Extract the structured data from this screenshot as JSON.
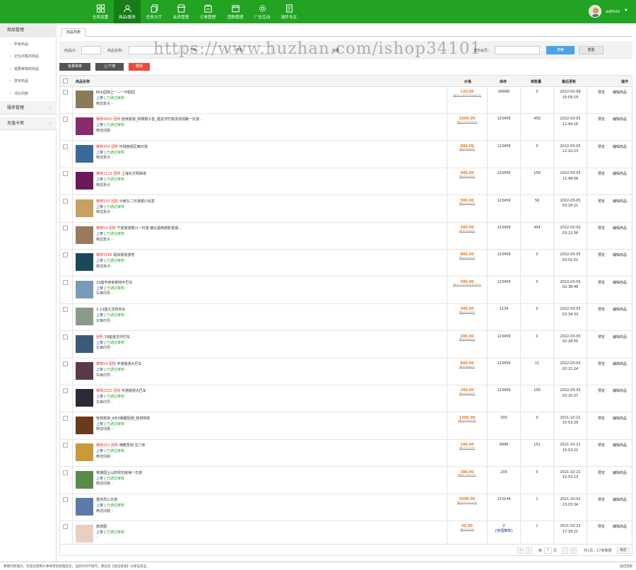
{
  "nav": {
    "items": [
      {
        "label": "全局设置",
        "icon": "grid-icon"
      },
      {
        "label": "商品/服务",
        "icon": "user-icon"
      },
      {
        "label": "任务大厅",
        "icon": "copy-icon"
      },
      {
        "label": "会员管理",
        "icon": "shop-icon"
      },
      {
        "label": "订单管理",
        "icon": "store-icon"
      },
      {
        "label": "团购管理",
        "icon": "calendar-icon"
      },
      {
        "label": "广告互动",
        "icon": "gear-icon"
      },
      {
        "label": "插件专区",
        "icon": "doc-icon"
      }
    ],
    "active_index": 1,
    "user": "admin"
  },
  "sidebar": {
    "section": "商品管理",
    "items": [
      "所有商品",
      "正在出售的商品",
      "需要审核的商品",
      "发布商品",
      "评价列表"
    ],
    "groups": [
      "服务管理",
      "充值卡密"
    ]
  },
  "tab": "商品列表",
  "filters": {
    "id_label": "商品ID：",
    "name_label": "商品名称：",
    "select1": "-- 不限 --",
    "select2": "-- 不限 --",
    "sales_label": "销量",
    "member_label": "发布会员：",
    "search": "搜索",
    "reset": "重置"
  },
  "watermark": "https://www.huzhan.com/ishop34101",
  "actions": {
    "review": "批量审核",
    "onoff": "上/下架",
    "delete": "删除"
  },
  "table": {
    "headers": {
      "name": "商品名称",
      "price": "价格",
      "stock": "库存",
      "sold": "销售量",
      "updated": "最后更新",
      "ops": "操作"
    },
    "status_on": "上架",
    "status_ok": "已通过审核",
    "preview": "预览",
    "edit": "编辑商品",
    "rows": [
      {
        "tag": "",
        "title": "四大园林之一—一中韵园",
        "cat": "精选景点 -",
        "price": "120.00",
        "oprice": "原价100000000元",
        "stock": "99999",
        "sold": "0",
        "date": "2022-03-08",
        "time": "16:09:19",
        "thumb": "#8a7a5a"
      },
      {
        "tag": "推荐4450 团购",
        "title": "桂林旅游_阳朔银子岩_遇龙河竹筏漂流线路一日游...",
        "cat": "精选线路 -",
        "price": "1000.00",
        "oprice": "原价10000元",
        "stock": "123456",
        "sold": "456",
        "date": "2022-03-05",
        "time": "12:44:16",
        "thumb": "#8a2a6a"
      },
      {
        "tag": "推荐454 团购",
        "title": "环球度假区两日游",
        "cat": "精选景点 -",
        "price": "888.00",
        "oprice": "原价999元",
        "stock": "123456",
        "sold": "0",
        "date": "2022-03-05",
        "time": "12:10:23",
        "thumb": "#3a6a9a"
      },
      {
        "tag": "推荐1123 团购",
        "title": "上海东方明珠塔",
        "cat": "精选景点 -",
        "price": "400.00",
        "oprice": "原价999元",
        "stock": "123456",
        "sold": "156",
        "date": "2022-03-05",
        "time": "11:48:58",
        "thumb": "#6a1a5a"
      },
      {
        "tag": "推荐535 团购",
        "title": "沙坡头二日游银川出发",
        "cat": "精选景点 -",
        "price": "300.00",
        "oprice": "原价999元",
        "stock": "123456",
        "sold": "56",
        "date": "2022-03-05",
        "time": "03:18:21",
        "thumb": "#c8a060"
      },
      {
        "tag": "推荐54 团购",
        "title": "宁夏旅游银川一日游 镇北堡西部影视城...",
        "cat": "精选景点 -",
        "price": "300.00",
        "oprice": "原价999元",
        "stock": "123456",
        "sold": "454",
        "date": "2022-03-05",
        "time": "03:12:36",
        "thumb": "#9a7a5a"
      },
      {
        "tag": "推荐1566",
        "title": "极目极夜游览",
        "cat": "精选景点 -",
        "price": "800.00",
        "oprice": "原价999元",
        "stock": "123456",
        "sold": "0",
        "date": "2022-03-05",
        "time": "03:01:52",
        "thumb": "#1a4a5a"
      },
      {
        "tag": "",
        "title": "19座丰田考斯特中巴车",
        "cat": "车辆向导 -",
        "price": "300.00",
        "oprice": "原价100000000元",
        "stock": "123456",
        "sold": "0",
        "date": "2022-03-05",
        "time": "02:38:48",
        "thumb": "#7a9aba"
      },
      {
        "tag": "",
        "title": "2-13座九龙商务车",
        "cat": "车辆向导 -",
        "price": "300.00",
        "oprice": "原价999元",
        "stock": "1234",
        "sold": "0",
        "date": "2022-03-05",
        "time": "02:34:33",
        "thumb": "#8a9a8a"
      },
      {
        "tag": "团购",
        "title": "19座金龙中巴车",
        "cat": "车辆向导 -",
        "price": "200.00",
        "oprice": "原价999元",
        "stock": "123456",
        "sold": "0",
        "date": "2022-03-05",
        "time": "02:28:50",
        "thumb": "#3a5a7a"
      },
      {
        "tag": "推荐54 团购",
        "title": "宇通旅游大巴车",
        "cat": "车辆向导 -",
        "price": "800.00",
        "oprice": "原价999元",
        "stock": "123456",
        "sold": "11",
        "date": "2022-03-05",
        "time": "02:21:24",
        "thumb": "#5a3a4a"
      },
      {
        "tag": "推荐2322 团购",
        "title": "宇通旅游大巴车",
        "cat": "车辆向导 -",
        "price": "300.00",
        "oprice": "原价999元",
        "stock": "123456",
        "sold": "156",
        "date": "2022-03-05",
        "time": "02:10:37",
        "thumb": "#2a2a3a"
      },
      {
        "tag": "",
        "title": "桂林旅游_4天3晚跟团游_桂林阳桂",
        "cat": "精选线路 -",
        "price": "1300.00",
        "oprice": "原价1000元",
        "stock": "200",
        "sold": "0",
        "date": "2021-10-21",
        "time": "15:53:29",
        "thumb": "#6a3a1a"
      },
      {
        "tag": "推荐252 团购",
        "title": "佛教圣地-五门寺",
        "cat": "精选线路 -",
        "price": "100.00",
        "oprice": "原价200元",
        "stock": "9999",
        "sold": "152",
        "date": "2021-10-21",
        "time": "15:53:22",
        "thumb": "#c89a3a"
      },
      {
        "tag": "",
        "title": "银滩国土山商坝无敌海一日游",
        "cat": "精选线路 -",
        "price": "300.00",
        "oprice": "原价1000元",
        "stock": "200",
        "sold": "0",
        "date": "2021-10-21",
        "time": "15:53:13",
        "thumb": "#5a8a4a"
      },
      {
        "tag": "",
        "title": "重庆周三日游",
        "cat": "精选线路 -",
        "price": "5000.00",
        "oprice": "原价10000元",
        "stock": "123144",
        "sold": "1",
        "date": "2021-10-02",
        "time": "23:03:34",
        "thumb": "#5a7aaa"
      },
      {
        "tag": "",
        "title": "旅游图",
        "cat": "-",
        "price": "50.00",
        "oprice": "原价60元",
        "stock": "2",
        "stock_note": "[管理推荐]",
        "sold": "1",
        "date": "2021-03-23",
        "time": "17:18:21",
        "thumb": "#e8d0c0"
      }
    ]
  },
  "pager": {
    "prev": "‹",
    "first": "«",
    "page_pre": "第",
    "page": "1",
    "page_post": "页",
    "next": "›",
    "last": "»",
    "summary": "共1页，17条数据",
    "confirm": "确定"
  },
  "footer": {
    "text": "尊敬的管理员，欢迎您使用大事导游后管理后台，当前时间不操作，建议您【退出登录】以保证安全。",
    "top": "返回顶部"
  },
  "colors": {
    "brand": "#22a322",
    "brand_dark": "#167d16",
    "accent_blue": "#4aa3e6",
    "danger": "#e84c3d",
    "price": "#e67e22"
  }
}
